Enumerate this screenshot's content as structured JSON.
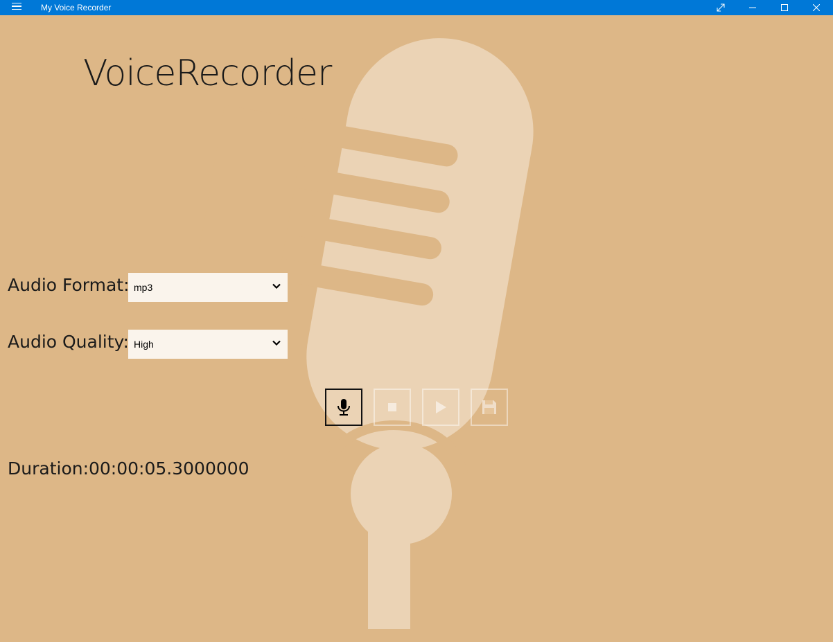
{
  "window": {
    "title": "My Voice Recorder",
    "titlebar_color": "#0078D7",
    "background_color": "#DDB787",
    "icons": [
      "hamburger-icon",
      "resize-icon",
      "minimize-icon",
      "maximize-icon",
      "close-icon"
    ]
  },
  "main": {
    "heading": "VoiceRecorder",
    "audio_format": {
      "label": "Audio Format:",
      "selected": "mp3"
    },
    "audio_quality": {
      "label": "Audio Quality:",
      "selected": "High"
    },
    "controls": [
      {
        "name": "record",
        "icon": "microphone-icon",
        "state": "active"
      },
      {
        "name": "stop",
        "icon": "stop-icon",
        "state": "disabled"
      },
      {
        "name": "play",
        "icon": "play-icon",
        "state": "disabled"
      },
      {
        "name": "save",
        "icon": "floppy-disk-icon",
        "state": "disabled"
      }
    ],
    "duration": {
      "label": "Duration:",
      "value": "00:00:05.3000000"
    }
  }
}
